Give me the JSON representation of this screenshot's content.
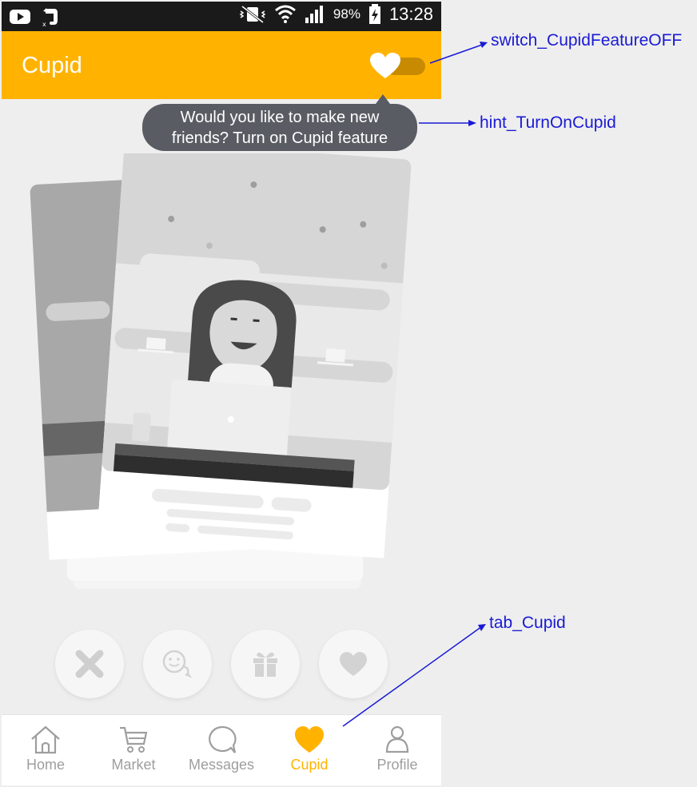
{
  "status_bar": {
    "battery": "98%",
    "time": "13:28"
  },
  "app_bar": {
    "title": "Cupid",
    "switch_icon": "heart-switch-icon"
  },
  "hint": {
    "line1": "Would you like to make new",
    "line2": "friends? Turn on Cupid feature"
  },
  "actions": [
    {
      "icon": "close-icon"
    },
    {
      "icon": "chat-smile-icon"
    },
    {
      "icon": "gift-icon"
    },
    {
      "icon": "heart-icon"
    }
  ],
  "tabs": [
    {
      "label": "Home",
      "icon": "home-icon"
    },
    {
      "label": "Market",
      "icon": "cart-icon"
    },
    {
      "label": "Messages",
      "icon": "chat-bubble-icon"
    },
    {
      "label": "Cupid",
      "icon": "heart-icon",
      "active": true
    },
    {
      "label": "Profile",
      "icon": "person-icon"
    }
  ],
  "annotations": {
    "switch": "switch_CupidFeatureOFF",
    "hint": "hint_TurnOnCupid",
    "tab": "tab_Cupid"
  },
  "colors": {
    "accent": "#ffb300",
    "status_bar": "#1a1a1a",
    "tooltip": "#595c63",
    "annotation": "#1a1ad6"
  }
}
